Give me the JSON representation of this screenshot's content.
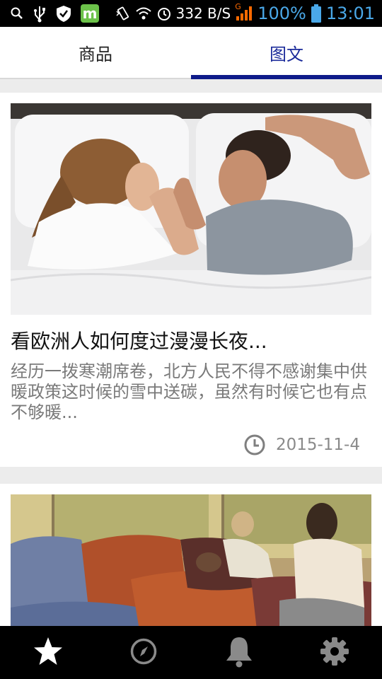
{
  "status_bar": {
    "speed": "332 B/S",
    "network": "G",
    "battery": "100%",
    "time": "13:01",
    "icons": [
      "search-icon",
      "usb-icon",
      "shield-icon",
      "m-app-icon",
      "vibrate-icon",
      "wifi-icon",
      "alarm-icon",
      "signal-icon",
      "battery-icon"
    ],
    "m_letter": "m"
  },
  "tabs": [
    {
      "label": "商品",
      "active": false
    },
    {
      "label": "图文",
      "active": true
    }
  ],
  "articles": [
    {
      "title": "看欧洲人如何度过漫漫长夜...",
      "description": "经历一拨寒潮席卷，北方人民不得不感谢集中供暖政策这时候的雪中送碳，虽然有时候它也有点不够暖...",
      "date": "2015-11-4",
      "image": "couple-sleeping-in-bed-photo"
    },
    {
      "title": "",
      "description": "",
      "date": "",
      "image": "living-room-with-cushions-photo"
    }
  ],
  "bottom_nav": [
    {
      "icon": "star-icon",
      "active": true
    },
    {
      "icon": "compass-icon",
      "active": false
    },
    {
      "icon": "bell-icon",
      "active": false
    },
    {
      "icon": "gear-icon",
      "active": false
    }
  ],
  "colors": {
    "tab_active": "#0f1b8a",
    "status_blue": "#4aa8e8",
    "background": "#ececec"
  }
}
